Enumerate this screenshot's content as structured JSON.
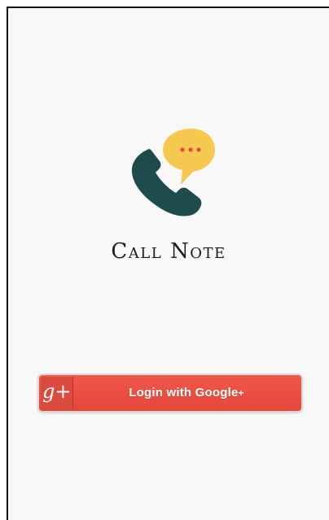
{
  "app": {
    "name": "Call Note"
  },
  "login": {
    "label": "Login with Google",
    "suffix": "+",
    "provider_icon_text": "g+"
  },
  "colors": {
    "phone": "#1f4b4d",
    "speech_bubble": "#f5c94f",
    "bubble_dots": "#e34a3d",
    "google_button": "#ea4d40"
  },
  "icons": {
    "logo": "phone-with-speech-bubble-icon",
    "google_plus": "google-plus-icon"
  }
}
